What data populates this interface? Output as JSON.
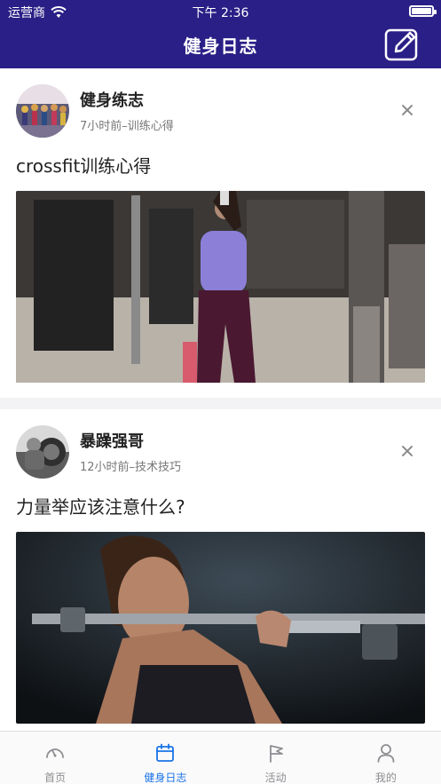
{
  "status_bar": {
    "carrier": "运营商",
    "time": "下午 2:36"
  },
  "nav": {
    "title": "健身日志",
    "edit_icon": "edit-icon"
  },
  "posts": [
    {
      "author": "健身练志",
      "meta": "7小时前–训练心得",
      "title": "crossfit训练心得"
    },
    {
      "author": "暴躁强哥",
      "meta": "12小时前–技术技巧",
      "title": "力量举应该注意什么?"
    }
  ],
  "tabs": [
    {
      "label": "首页",
      "icon": "gauge-icon",
      "active": false
    },
    {
      "label": "健身日志",
      "icon": "calendar-icon",
      "active": true
    },
    {
      "label": "活动",
      "icon": "flag-icon",
      "active": false
    },
    {
      "label": "我的",
      "icon": "user-icon",
      "active": false
    }
  ],
  "colors": {
    "nav": "#2a1f86",
    "active_tab": "#1a73e8",
    "inactive_tab": "#8e8e93"
  }
}
